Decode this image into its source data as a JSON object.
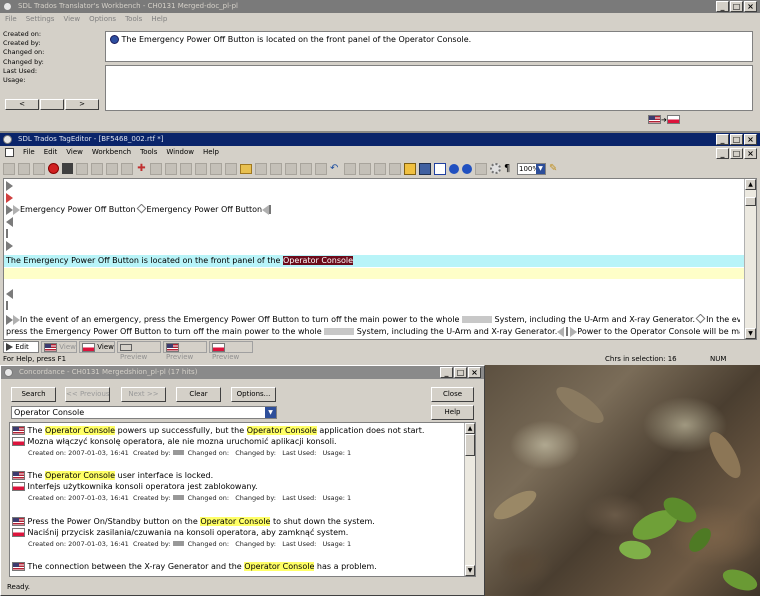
{
  "workbench": {
    "title": "SDL Trados Translator's Workbench - CH0131 Merged-doc_pl-pl",
    "menu": [
      "File",
      "Settings",
      "View",
      "Options",
      "Tools",
      "Help"
    ],
    "fields": [
      "Created on:",
      "Created by:",
      "Changed on:",
      "Changed by:",
      "Last Used:",
      "Usage:"
    ],
    "source_segment": "The Emergency Power Off Button is located on the front panel of the Operator Console.",
    "nav_prev": "<",
    "nav_next": ">"
  },
  "tageditor": {
    "title": "SDL Trados TagEditor - [BF5468_002.rtf *]",
    "menu": [
      "File",
      "Edit",
      "View",
      "Workbench",
      "Tools",
      "Window",
      "Help"
    ],
    "zoom": "100%",
    "segments": {
      "s1_a": "Emergency Power Off Button",
      "s1_b": "Emergency Power Off Button",
      "active_pre": "The Emergency Power Off Button is located on the front panel of the ",
      "active_sel": "Operator Console",
      "p1": "In the event of an emergency, press the Emergency Power Off Button to turn off the main power to the whole",
      "p1b": "System, including the U-Arm and X-ray Generator.",
      "p1c": "In the event of an emergency,",
      "p2": "press the Emergency Power Off Button to turn off the main power to the whole",
      "p2b": "System, including the U-Arm and X-ray Generator.",
      "p2c": "Power to the Operator Console will be maintained by the UPS"
    },
    "tabs": [
      "Edit",
      "View",
      "Preview",
      "Preview",
      "Preview"
    ],
    "status_left": "For Help, press F1",
    "status_chrs": "Chrs in selection: 16",
    "status_num": "NUM"
  },
  "concordance": {
    "title": "Concordance - CH0131 Mergedshion_pl-pl (17 hits)",
    "search_btn": "Search",
    "prev_btn": "<< Previous",
    "next_btn": "Next >>",
    "clear_btn": "Clear",
    "options_btn": "Options...",
    "close_btn": "Close",
    "help_btn": "Help",
    "query": "Operator Console",
    "results": [
      {
        "src_pre": "The ",
        "src_hl1": "Operator Console",
        "src_mid": " powers up successfully, but the ",
        "src_hl2": "Operator Console",
        "src_post": " application does not start.",
        "tgt": "Mozna włączyć konsolę operatora, ale nie mozna uruchomić aplikacji konsoli.",
        "created_on": "2007-01-03, 16:41",
        "usage": "1"
      },
      {
        "src_pre": "The ",
        "src_hl1": "Operator Console",
        "src_mid": " user interface is locked.",
        "src_hl2": "",
        "src_post": "",
        "tgt": "Interfejs użytkownika konsoli operatora jest zablokowany.",
        "created_on": "2007-01-03, 16:41",
        "usage": "1"
      },
      {
        "src_pre": "Press the Power On/Standby button on the ",
        "src_hl1": "Operator Console",
        "src_mid": " to shut down the system.",
        "src_hl2": "",
        "src_post": "",
        "tgt": "Naciśnij przycisk zasilania/czuwania na konsoli operatora, aby zamknąć system.",
        "created_on": "2007-01-03, 16:41",
        "usage": "1"
      },
      {
        "src_pre": "The connection between the X-ray Generator and the ",
        "src_hl1": "Operator Console",
        "src_mid": " has a problem.",
        "src_hl2": "",
        "src_post": "",
        "tgt": "",
        "created_on": "",
        "usage": ""
      }
    ],
    "meta_labels": {
      "created_on": "Created on:",
      "created_by": "Created by:",
      "changed_on": "Changed on:",
      "changed_by": "Changed by:",
      "last_used": "Last Used:",
      "usage": "Usage:"
    },
    "status": "Ready."
  },
  "colors": {
    "titlebar_active": "#0a246a",
    "active_segment": "#b8f4f8",
    "target_segment": "#fefec8",
    "highlight": "#ffff66",
    "selection": "#6b0a1a"
  }
}
